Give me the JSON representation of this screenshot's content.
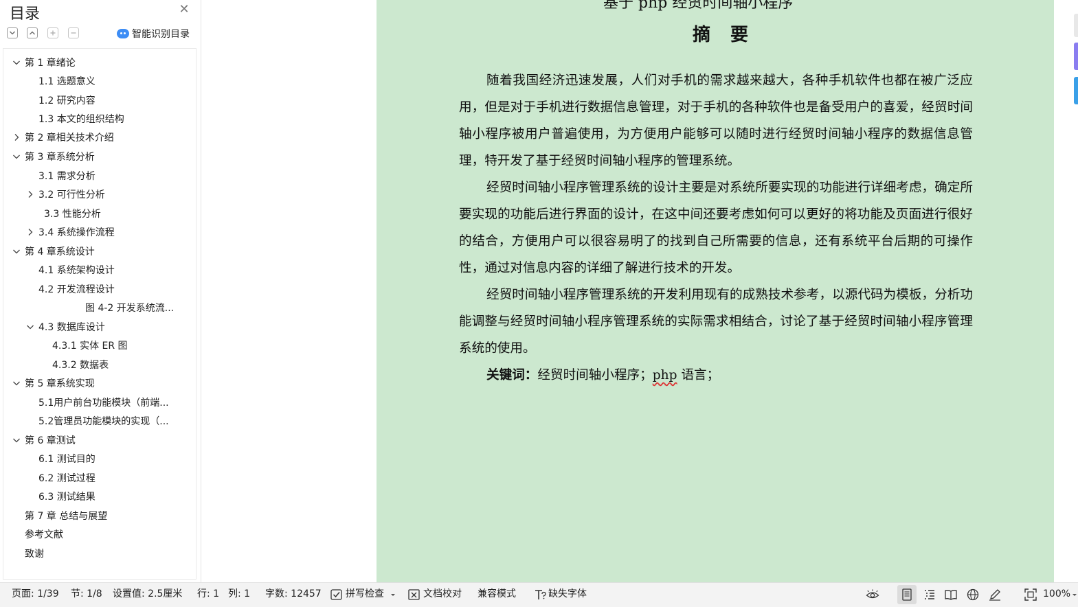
{
  "sidebar": {
    "title": "目录",
    "smart_toc_label": "智能识别目录",
    "toc": [
      {
        "label": "第 1 章绪论",
        "expanded": true
      },
      {
        "label": "1.1 选题意义"
      },
      {
        "label": "1.2 研究内容"
      },
      {
        "label": "1.3 本文的组织结构"
      },
      {
        "label": "第 2 章相关技术介绍",
        "expanded": false
      },
      {
        "label": "第 3 章系统分析",
        "expanded": true
      },
      {
        "label": "3.1 需求分析"
      },
      {
        "label": "3.2 可行性分析",
        "expanded": false
      },
      {
        "label": "3.3  性能分析"
      },
      {
        "label": "3.4  系统操作流程",
        "expanded": false
      },
      {
        "label": "第 4 章系统设计",
        "expanded": true
      },
      {
        "label": "4.1 系统架构设计"
      },
      {
        "label": "4.2 开发流程设计"
      },
      {
        "label": "图 4-2 开发系统流..."
      },
      {
        "label": "4.3 数据库设计",
        "expanded": true
      },
      {
        "label": "4.3.1 实体 ER 图"
      },
      {
        "label": "4.3.2 数据表"
      },
      {
        "label": "第 5 章系统实现",
        "expanded": true
      },
      {
        "label": "5.1用户前台功能模块（前端..."
      },
      {
        "label": "5.2管理员功能模块的实现（..."
      },
      {
        "label": "第 6 章测试",
        "expanded": true
      },
      {
        "label": "6.1 测试目的"
      },
      {
        "label": "6.2 测试过程"
      },
      {
        "label": "6.3 测试结果"
      },
      {
        "label": "第 7 章  总结与展望"
      },
      {
        "label": "参考文献"
      },
      {
        "label": "致谢"
      }
    ]
  },
  "document": {
    "title_fragment": "基于 php 经贸时间轴小程序",
    "heading": "摘 要",
    "paragraphs": [
      "随着我国经济迅速发展，人们对手机的需求越来越大，各种手机软件也都在被广泛应用，但是对于手机进行数据信息管理，对于手机的各种软件也是备受用户的喜爱，经贸时间轴小程序被用户普遍使用，为方便用户能够可以随时进行经贸时间轴小程序的数据信息管理，特开发了基于经贸时间轴小程序的管理系统。",
      "经贸时间轴小程序管理系统的设计主要是对系统所要实现的功能进行详细考虑，确定所要实现的功能后进行界面的设计，在这中间还要考虑如何可以更好的将功能及页面进行很好的结合，方便用户可以很容易明了的找到自己所需要的信息，还有系统平台后期的可操作性，通过对信息内容的详细了解进行技术的开发。",
      "经贸时间轴小程序管理系统的开发利用现有的成熟技术参考，以源代码为模板，分析功能调整与经贸时间轴小程序管理系统的实际需求相结合，讨论了基于经贸时间轴小程序管理系统的使用。"
    ],
    "keywords_label": "关键词：",
    "keywords_pre": "经贸时间轴小程序；",
    "keywords_php": "php",
    "keywords_post": " 语言；",
    "page_color": "#cce8cf"
  },
  "statusbar": {
    "page": "页面: 1/39",
    "section": "节: 1/8",
    "setting": "设置值: 2.5厘米",
    "row": "行: 1",
    "col": "列: 1",
    "wordcount": "字数: 12457",
    "spellcheck": "拼写检查",
    "proofread": "文档校对",
    "compat": "兼容模式",
    "missing_font": "缺失字体",
    "zoom": "100%"
  }
}
